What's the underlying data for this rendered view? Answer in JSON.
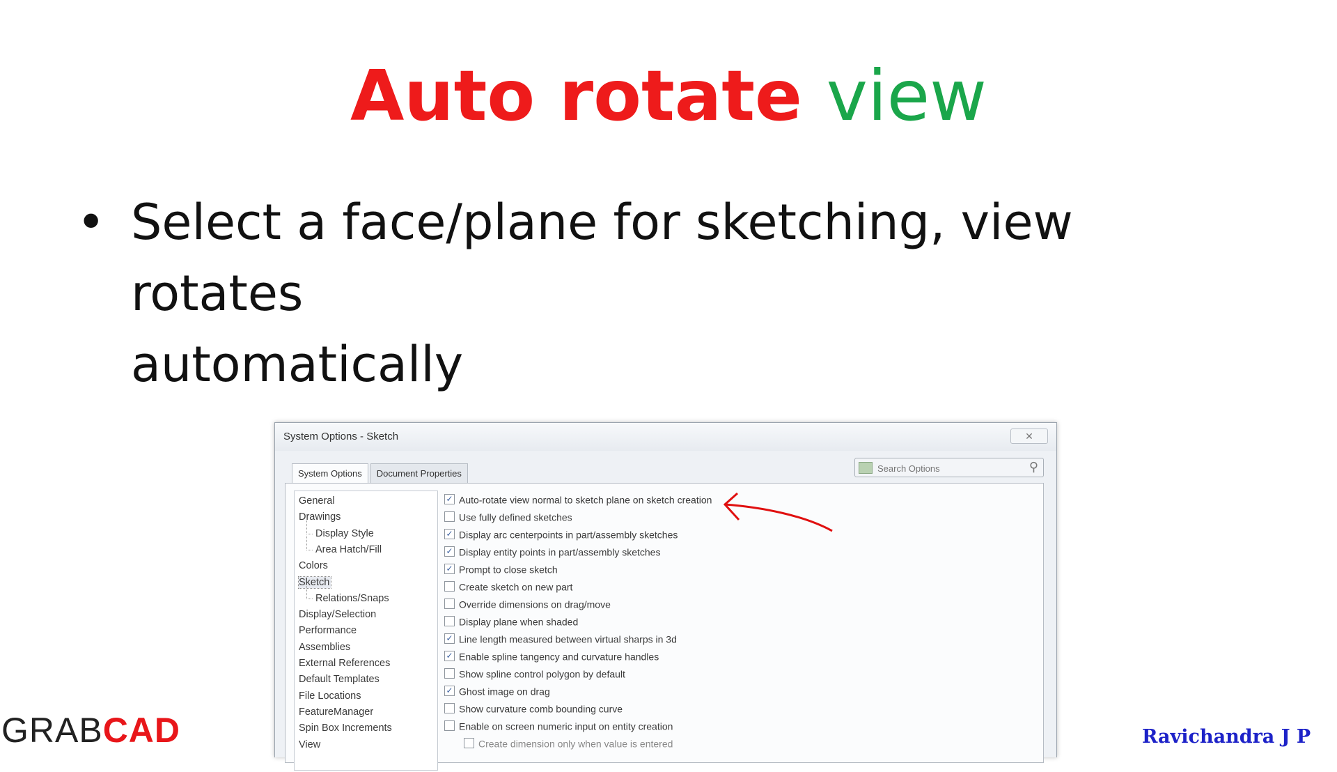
{
  "slide": {
    "title_part1": "Auto rotate",
    "title_part2": "view",
    "title_part1_color": "#ee1b1b",
    "title_part2_color": "#1aa64a",
    "bullet_symbol": "•",
    "bullet_line1": "Select a face/plane for sketching, view rotates",
    "bullet_line2": "automatically"
  },
  "dialog": {
    "title": "System Options - Sketch",
    "close_glyph": "✕",
    "tabs": [
      {
        "label": "System Options",
        "active": true
      },
      {
        "label": "Document Properties",
        "active": false
      }
    ],
    "search": {
      "placeholder": "Search Options",
      "icon": "magnifier-icon"
    },
    "tree": [
      {
        "label": "General",
        "sub": false,
        "selected": false
      },
      {
        "label": "Drawings",
        "sub": false,
        "selected": false
      },
      {
        "label": "Display Style",
        "sub": true,
        "selected": false
      },
      {
        "label": "Area Hatch/Fill",
        "sub": true,
        "selected": false
      },
      {
        "label": "Colors",
        "sub": false,
        "selected": false
      },
      {
        "label": "Sketch",
        "sub": false,
        "selected": true
      },
      {
        "label": "Relations/Snaps",
        "sub": true,
        "selected": false
      },
      {
        "label": "Display/Selection",
        "sub": false,
        "selected": false
      },
      {
        "label": "Performance",
        "sub": false,
        "selected": false
      },
      {
        "label": "Assemblies",
        "sub": false,
        "selected": false
      },
      {
        "label": "External References",
        "sub": false,
        "selected": false
      },
      {
        "label": "Default Templates",
        "sub": false,
        "selected": false
      },
      {
        "label": "File Locations",
        "sub": false,
        "selected": false
      },
      {
        "label": "FeatureManager",
        "sub": false,
        "selected": false
      },
      {
        "label": "Spin Box Increments",
        "sub": false,
        "selected": false
      },
      {
        "label": "View",
        "sub": false,
        "selected": false
      }
    ],
    "options": [
      {
        "label": "Auto-rotate view normal to sketch plane on sketch creation",
        "checked": true,
        "indent": false
      },
      {
        "label": "Use fully defined sketches",
        "checked": false,
        "indent": false
      },
      {
        "label": "Display arc centerpoints in part/assembly sketches",
        "checked": true,
        "indent": false
      },
      {
        "label": "Display entity points in part/assembly sketches",
        "checked": true,
        "indent": false
      },
      {
        "label": "Prompt to close sketch",
        "checked": true,
        "indent": false
      },
      {
        "label": "Create sketch on new part",
        "checked": false,
        "indent": false
      },
      {
        "label": "Override dimensions on drag/move",
        "checked": false,
        "indent": false
      },
      {
        "label": "Display plane when shaded",
        "checked": false,
        "indent": false
      },
      {
        "label": "Line length measured between virtual sharps in 3d",
        "checked": true,
        "indent": false
      },
      {
        "label": "Enable spline tangency and curvature handles",
        "checked": true,
        "indent": false
      },
      {
        "label": "Show spline control polygon by default",
        "checked": false,
        "indent": false
      },
      {
        "label": "Ghost image on drag",
        "checked": true,
        "indent": false
      },
      {
        "label": "Show curvature comb bounding curve",
        "checked": false,
        "indent": false
      },
      {
        "label": "Enable on screen numeric input on entity creation",
        "checked": false,
        "indent": false
      },
      {
        "label": "Create dimension only when value is entered",
        "checked": false,
        "indent": true
      }
    ],
    "check_glyph": "✓",
    "annotation_color": "#e01010"
  },
  "footer": {
    "logo_part1": "GRAB",
    "logo_part2": "CAD",
    "author": "Ravichandra J P"
  }
}
